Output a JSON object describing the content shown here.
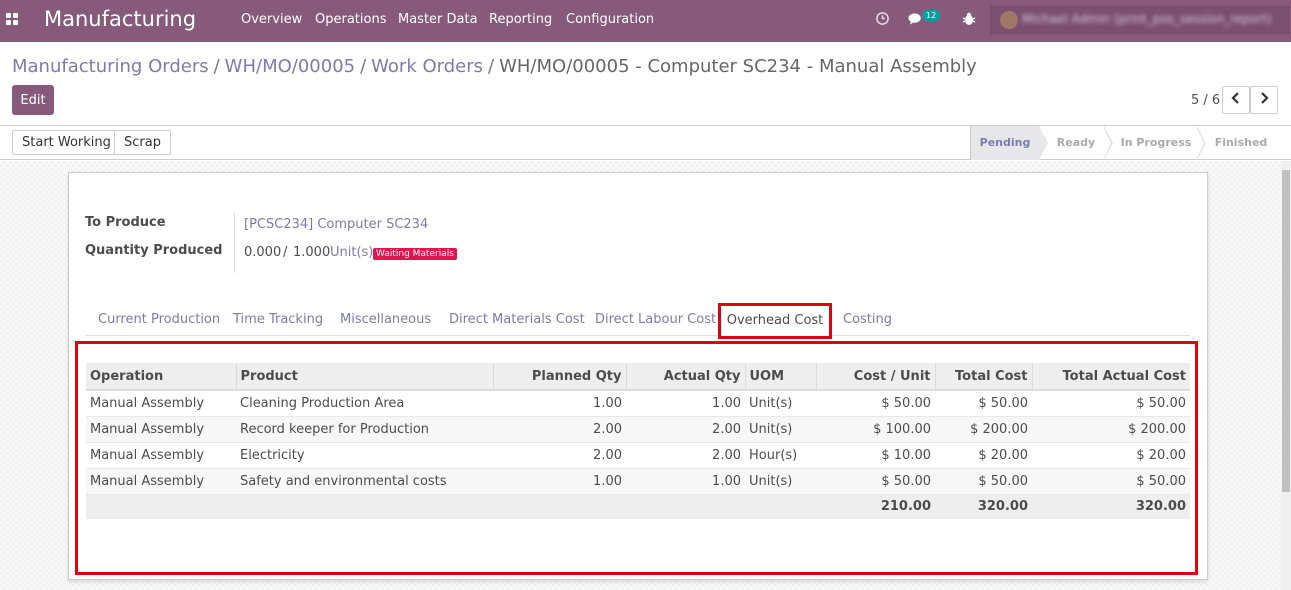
{
  "navbar": {
    "brand": "Manufacturing",
    "menu": [
      "Overview",
      "Operations",
      "Master Data",
      "Reporting",
      "Configuration"
    ],
    "messages_count": "12",
    "user_name": "Michael Admin (print_pos_session_report)",
    "color": "#875a7b"
  },
  "breadcrumb": {
    "items": [
      "Manufacturing Orders",
      "WH/MO/00005",
      "Work Orders"
    ],
    "current": "WH/MO/00005 - Computer SC234 - Manual Assembly"
  },
  "buttons": {
    "edit": "Edit",
    "start_working": "Start Working",
    "scrap": "Scrap"
  },
  "pager": {
    "value": "5 / 6"
  },
  "stages": [
    "Pending",
    "Ready",
    "In Progress",
    "Finished"
  ],
  "active_stage": "Pending",
  "form": {
    "to_produce_label": "To Produce",
    "to_produce_value": "[PCSC234] Computer SC234",
    "qty_label": "Quantity Produced",
    "qty_done": "0.000",
    "qty_sep": "/",
    "qty_total": "1.000",
    "qty_uom": "Unit(s)",
    "state_tag": "Waiting Materials"
  },
  "tabs": [
    "Current Production",
    "Time Tracking",
    "Miscellaneous",
    "Direct Materials Cost",
    "Direct Labour Cost",
    "Overhead Cost",
    "Costing"
  ],
  "active_tab": "Overhead Cost",
  "table": {
    "columns": [
      "Operation",
      "Product",
      "Planned Qty",
      "Actual Qty",
      "UOM",
      "Cost / Unit",
      "Total Cost",
      "Total Actual Cost"
    ],
    "rows": [
      [
        "Manual Assembly",
        "Cleaning Production Area",
        "1.00",
        "1.00",
        "Unit(s)",
        "$ 50.00",
        "$ 50.00",
        "$ 50.00"
      ],
      [
        "Manual Assembly",
        "Record keeper for Production",
        "2.00",
        "2.00",
        "Unit(s)",
        "$ 100.00",
        "$ 200.00",
        "$ 200.00"
      ],
      [
        "Manual Assembly",
        "Electricity",
        "2.00",
        "2.00",
        "Hour(s)",
        "$ 10.00",
        "$ 20.00",
        "$ 20.00"
      ],
      [
        "Manual Assembly",
        "Safety and environmental costs",
        "1.00",
        "1.00",
        "Unit(s)",
        "$ 50.00",
        "$ 50.00",
        "$ 50.00"
      ]
    ],
    "totals": {
      "cost_unit": "210.00",
      "total_cost": "320.00",
      "total_actual": "320.00"
    }
  },
  "highlight_color": "#e0000f"
}
